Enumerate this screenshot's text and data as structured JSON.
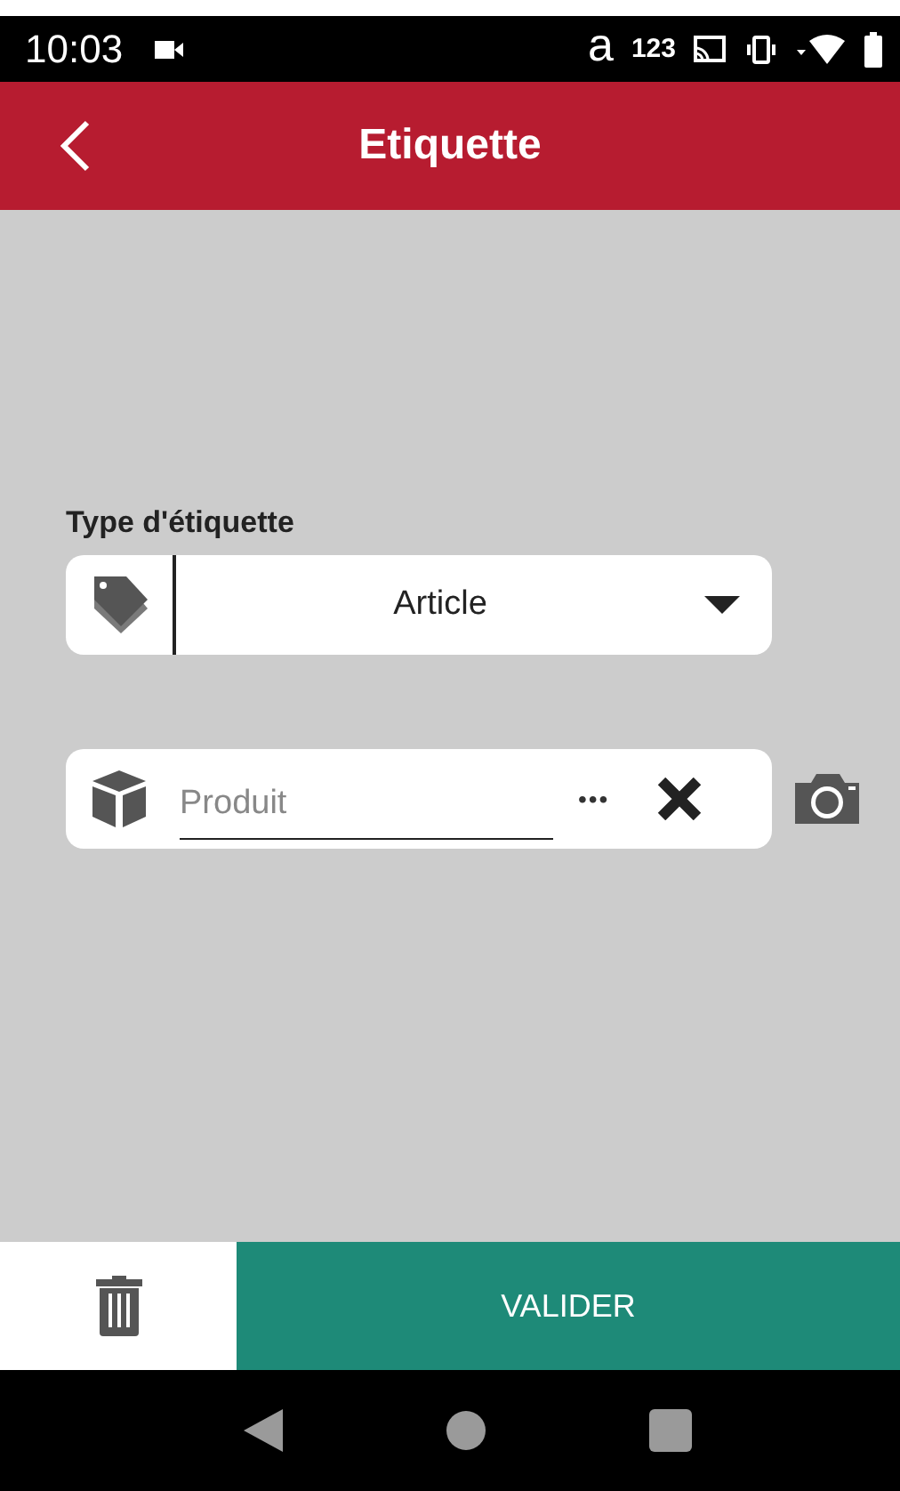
{
  "status_bar": {
    "time": "10:03",
    "notifications": [
      "a",
      "123"
    ]
  },
  "header": {
    "title": "Etiquette"
  },
  "label_type": {
    "label": "Type d'étiquette"
  },
  "type_select": {
    "value": "Article"
  },
  "product_field": {
    "placeholder": "Produit"
  },
  "more_button": {
    "label": "•••"
  },
  "footer": {
    "validate": "VALIDER"
  }
}
